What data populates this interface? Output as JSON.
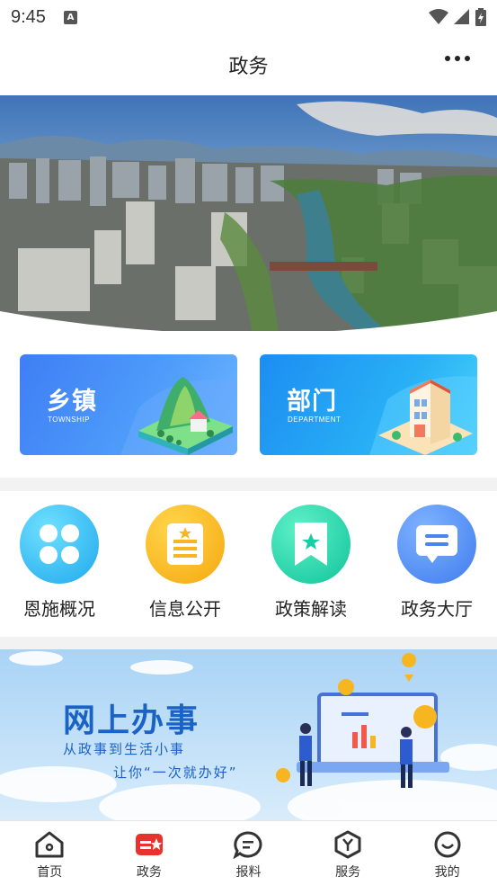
{
  "status_bar": {
    "time": "9:45",
    "notification_icon": "A"
  },
  "header": {
    "title": "政务",
    "more_icon": "more-dots-icon"
  },
  "cards": [
    {
      "title": "乡镇",
      "subtitle": "TOWNSHIP"
    },
    {
      "title": "部门",
      "subtitle": "DEPARTMENT"
    }
  ],
  "grid": [
    {
      "label": "恩施概况",
      "icon": "clover-icon",
      "color": "#2eb8f0"
    },
    {
      "label": "信息公开",
      "icon": "document-icon",
      "color": "#f7b51f"
    },
    {
      "label": "政策解读",
      "icon": "bookmark-star-icon",
      "color": "#17cfa6"
    },
    {
      "label": "政务大厅",
      "icon": "chat-icon",
      "color": "#4a84f0"
    }
  ],
  "promo": {
    "title": "网上办事",
    "line1": "从政事到生活小事",
    "line2": "让你“一次就办好”"
  },
  "tabbar": [
    {
      "label": "首页",
      "icon": "home-icon"
    },
    {
      "label": "政务",
      "icon": "government-icon",
      "active": true
    },
    {
      "label": "报料",
      "icon": "message-icon"
    },
    {
      "label": "服务",
      "icon": "service-icon"
    },
    {
      "label": "我的",
      "icon": "profile-icon"
    }
  ],
  "colors": {
    "active_red": "#e8322e",
    "icon_dark": "#333333"
  }
}
